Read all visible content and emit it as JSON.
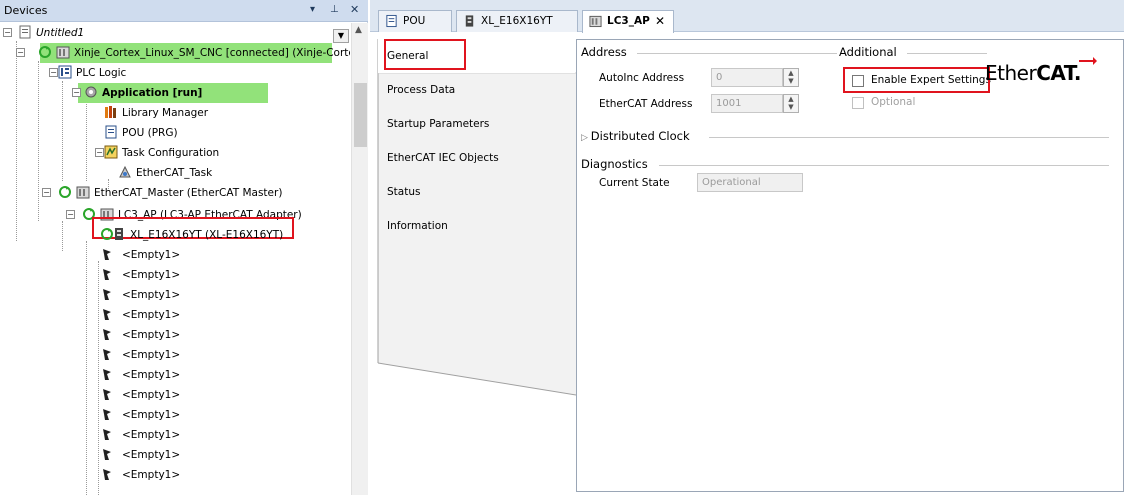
{
  "devices": {
    "title": "Devices",
    "controls": [
      "▾",
      "⊥",
      "✕"
    ],
    "tree": [
      {
        "label": "Untitled1",
        "icon": "project-icon"
      },
      {
        "label": "Xinje_Cortex_Linux_SM_CNC [connected] (Xinje-Cortex-L",
        "icon": "device-icon"
      },
      {
        "label": "PLC Logic",
        "icon": "plc-logic-icon"
      },
      {
        "label": "Application [run]",
        "icon": "application-gear-icon"
      },
      {
        "label": "Library Manager",
        "icon": "library-icon"
      },
      {
        "label": "POU (PRG)",
        "icon": "pou-icon"
      },
      {
        "label": "Task Configuration",
        "icon": "task-config-icon"
      },
      {
        "label": "EtherCAT_Task",
        "icon": "task-icon"
      },
      {
        "label": "EtherCAT_Master (EtherCAT Master)",
        "icon": "ethercat-master-icon"
      },
      {
        "label": "LC3_AP (LC3-AP EtherCAT Adapter)",
        "icon": "adapter-icon"
      },
      {
        "label": "XL_E16X16YT (XL-E16X16YT)",
        "icon": "io-module-icon"
      },
      {
        "label": "<Empty1>",
        "icon": "slot-icon"
      },
      {
        "label": "<Empty1>",
        "icon": "slot-icon"
      },
      {
        "label": "<Empty1>",
        "icon": "slot-icon"
      },
      {
        "label": "<Empty1>",
        "icon": "slot-icon"
      },
      {
        "label": "<Empty1>",
        "icon": "slot-icon"
      },
      {
        "label": "<Empty1>",
        "icon": "slot-icon"
      },
      {
        "label": "<Empty1>",
        "icon": "slot-icon"
      },
      {
        "label": "<Empty1>",
        "icon": "slot-icon"
      },
      {
        "label": "<Empty1>",
        "icon": "slot-icon"
      },
      {
        "label": "<Empty1>",
        "icon": "slot-icon"
      },
      {
        "label": "<Empty1>",
        "icon": "slot-icon"
      },
      {
        "label": "<Empty1>",
        "icon": "slot-icon"
      }
    ]
  },
  "tabs": [
    {
      "label": "POU",
      "icon": "pou-icon"
    },
    {
      "label": "XL_E16X16YT",
      "icon": "io-module-icon"
    },
    {
      "label": "LC3_AP",
      "icon": "adapter-icon",
      "close": "✕"
    }
  ],
  "side_tabs": [
    "General",
    "Process Data",
    "Startup Parameters",
    "EtherCAT IEC Objects",
    "Status",
    "Information"
  ],
  "general": {
    "address_group": "Address",
    "autoinc_label": "AutoInc Address",
    "autoinc_value": "0",
    "ethercat_address_label": "EtherCAT Address",
    "ethercat_address_value": "1001",
    "additional_group": "Additional",
    "expert_label": "Enable Expert Settings",
    "optional_label": "Optional",
    "distributed_clock": "Distributed Clock",
    "diagnostics_group": "Diagnostics",
    "current_state_label": "Current State",
    "current_state_value": "Operational",
    "logo_text_plain": "Ether",
    "logo_text_bold": "CAT."
  },
  "colors": {
    "highlight_green": "#92e27a",
    "annotation_red": "#e0141e",
    "accent_blue": "#1e395b"
  }
}
